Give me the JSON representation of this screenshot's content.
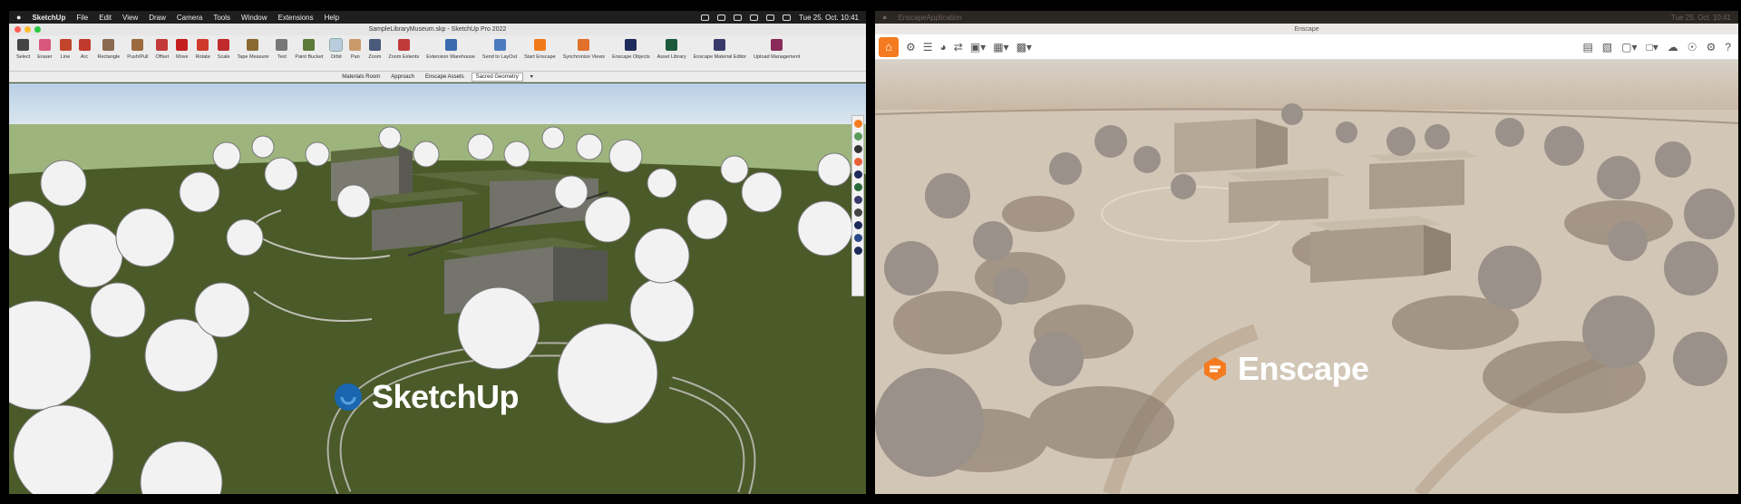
{
  "sketchup": {
    "menubar": {
      "apple": "",
      "app": "SketchUp",
      "menus": [
        "File",
        "Edit",
        "View",
        "Draw",
        "Camera",
        "Tools",
        "Window",
        "Extensions",
        "Help"
      ],
      "datetime": "Tue 25. Oct. 10:41"
    },
    "window_title": "SampleLibraryMuseum.skp - SketchUp Pro 2022",
    "tools": [
      {
        "label": "Select",
        "icon": "select-arrow-icon",
        "color": "#444444"
      },
      {
        "label": "Eraser",
        "icon": "eraser-icon",
        "color": "#d9577b"
      },
      {
        "label": "Line",
        "icon": "pencil-icon",
        "color": "#c2452c"
      },
      {
        "label": "Arc",
        "icon": "arc-icon",
        "color": "#c23a2c"
      },
      {
        "label": "Rectangle",
        "icon": "rectangle-icon",
        "color": "#8a6a50"
      },
      {
        "label": "Push/Pull",
        "icon": "push-pull-icon",
        "color": "#9c6a3e"
      },
      {
        "label": "Offset",
        "icon": "offset-icon",
        "color": "#c23a3a"
      },
      {
        "label": "Move",
        "icon": "move-icon",
        "color": "#c41e1e"
      },
      {
        "label": "Rotate",
        "icon": "rotate-icon",
        "color": "#d03a2a"
      },
      {
        "label": "Scale",
        "icon": "scale-icon",
        "color": "#c02a2a"
      },
      {
        "label": "Tape Measure",
        "icon": "tape-measure-icon",
        "color": "#8a6a30"
      },
      {
        "label": "Text",
        "icon": "text-icon",
        "color": "#777777"
      },
      {
        "label": "Paint Bucket",
        "icon": "paint-bucket-icon",
        "color": "#5a7a3a"
      },
      {
        "label": "Orbit",
        "icon": "orbit-icon",
        "color": "#6a7a9a"
      },
      {
        "label": "Pan",
        "icon": "pan-hand-icon",
        "color": "#c99a6a"
      },
      {
        "label": "Zoom",
        "icon": "zoom-icon",
        "color": "#4a5a7a"
      },
      {
        "label": "Zoom Extents",
        "icon": "zoom-extents-icon",
        "color": "#c03a3a"
      },
      {
        "label": "Extension Warehouse",
        "icon": "extension-warehouse-icon",
        "color": "#3a6ab0"
      },
      {
        "label": "Send to LayOut",
        "icon": "layout-icon",
        "color": "#4a7ac0"
      },
      {
        "label": "Start Enscape",
        "icon": "enscape-start-icon",
        "color": "#f07a1a"
      },
      {
        "label": "Synchronize Views",
        "icon": "sync-views-icon",
        "color": "#e0702a"
      },
      {
        "label": "Enscape Objects",
        "icon": "enscape-objects-icon",
        "color": "#1e2a5a"
      },
      {
        "label": "Asset Library",
        "icon": "asset-library-icon",
        "color": "#1a5a3a"
      },
      {
        "label": "Enscape Material Editor",
        "icon": "material-editor-icon",
        "color": "#3a3a6a"
      },
      {
        "label": "Upload Management",
        "icon": "upload-cloud-icon",
        "color": "#8a2a5a"
      }
    ],
    "scene_tabs": [
      "Materials Room",
      "Approach",
      "Enscape Assets",
      "Sacred Geometry"
    ],
    "selected_tab": "Sacred Geometry",
    "logo_text": "SketchUp",
    "logo_color": "#1a66b0"
  },
  "enscape": {
    "menubar_app": "EnscapeApplication",
    "datetime": "Tue 25. Oct. 10:41",
    "window_title": "Enscape",
    "accent": "#f47b20",
    "logo_text": "Enscape"
  }
}
